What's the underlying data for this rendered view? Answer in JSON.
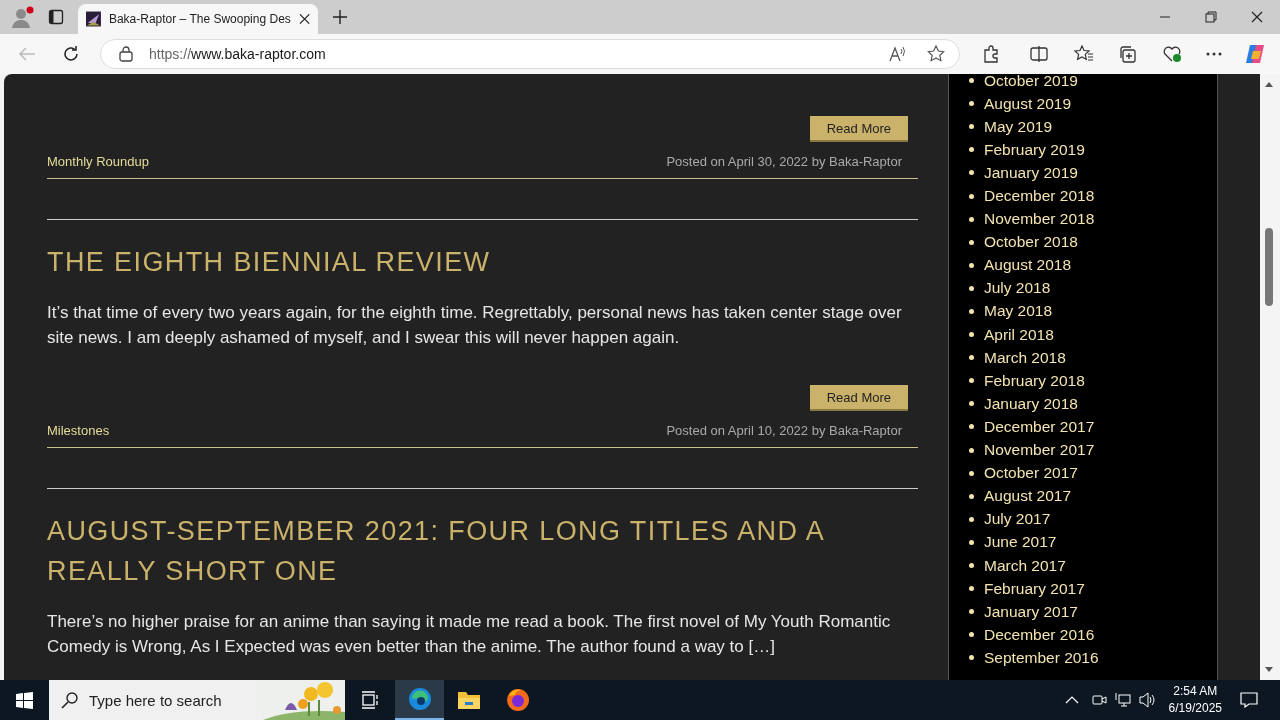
{
  "browser": {
    "tab_title": "Baka-Raptor – The Swooping Des",
    "address": {
      "scheme": "https://",
      "host": "www.baka-raptor.com"
    }
  },
  "posts": [
    {
      "read_more": "Read More",
      "category": "Monthly Roundup",
      "meta": "Posted on April 30, 2022 by Baka-Raptor"
    },
    {
      "title": "THE EIGHTH BIENNIAL REVIEW",
      "excerpt": "It’s that time of every two years again, for the eighth time. Regrettably, personal news has taken center stage over site news. I am deeply ashamed of myself, and I swear this will never happen again.",
      "read_more": "Read More",
      "category": "Milestones",
      "meta": "Posted on April 10, 2022 by Baka-Raptor"
    },
    {
      "title": "AUGUST-SEPTEMBER 2021: FOUR LONG TITLES AND A REALLY SHORT ONE",
      "excerpt": "There’s no higher praise for an anime than saying it made me read a book. The first novel of My Youth Romantic Comedy is Wrong, As I Expected was even better than the anime. The author found a way to […]"
    }
  ],
  "archives": [
    "October 2019",
    "August 2019",
    "May 2019",
    "February 2019",
    "January 2019",
    "December 2018",
    "November 2018",
    "October 2018",
    "August 2018",
    "July 2018",
    "May 2018",
    "April 2018",
    "March 2018",
    "February 2018",
    "January 2018",
    "December 2017",
    "November 2017",
    "October 2017",
    "August 2017",
    "July 2017",
    "June 2017",
    "March 2017",
    "February 2017",
    "January 2017",
    "December 2016",
    "September 2016"
  ],
  "taskbar": {
    "search": {
      "placeholder": "Type here to search"
    },
    "time": "2:54 AM",
    "date": "6/19/2025"
  }
}
